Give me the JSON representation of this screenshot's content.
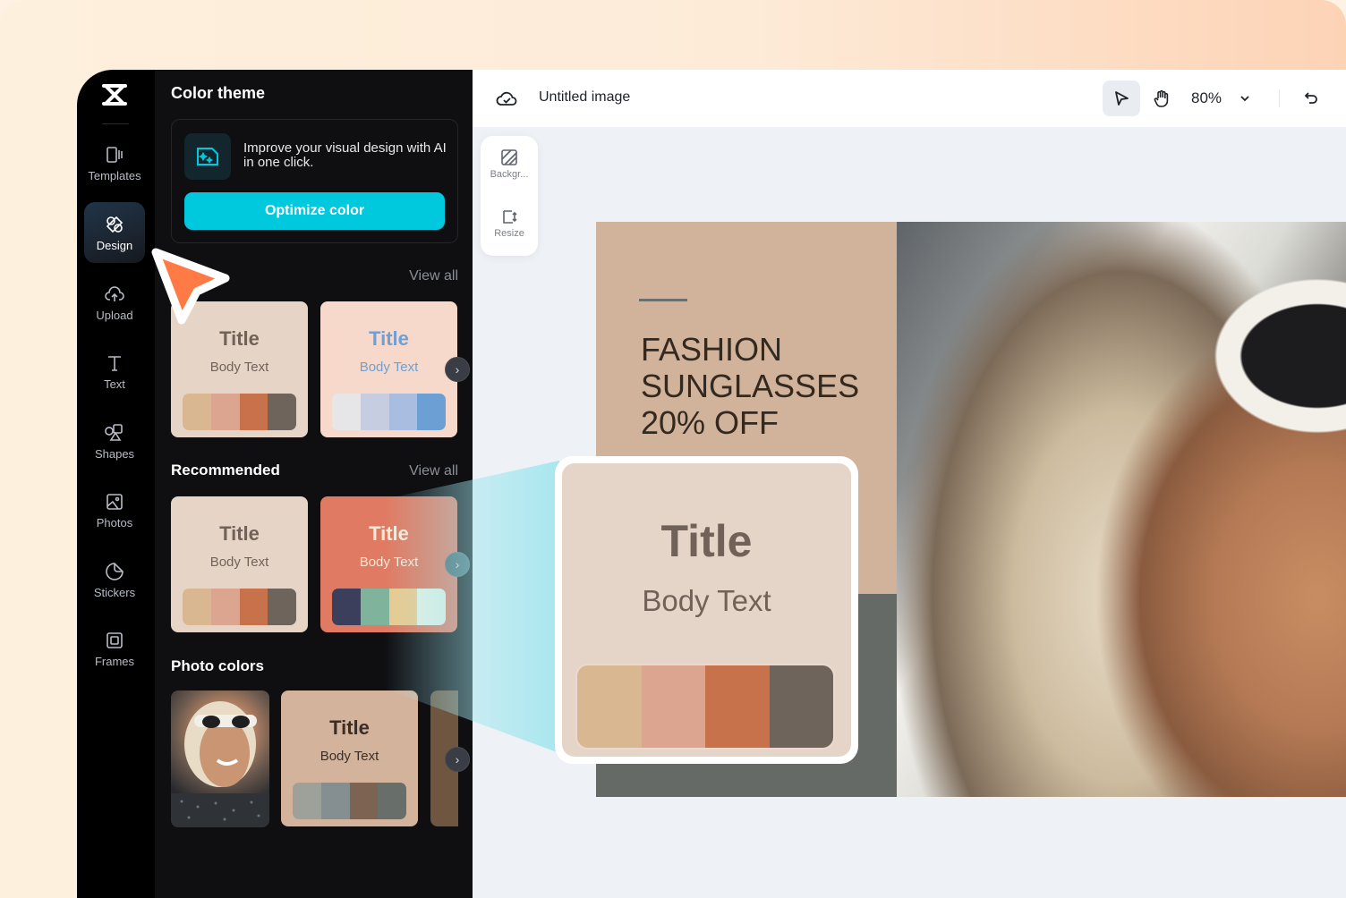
{
  "app": {
    "document_title": "Untitled image",
    "zoom_level": "80%"
  },
  "rail": {
    "logo": "capcut-logo-icon",
    "items": [
      {
        "label": "Templates",
        "icon": "templates-icon",
        "active": false
      },
      {
        "label": "Design",
        "icon": "design-icon",
        "active": true
      },
      {
        "label": "Upload",
        "icon": "upload-cloud-icon",
        "active": false
      },
      {
        "label": "Text",
        "icon": "text-icon",
        "active": false
      },
      {
        "label": "Shapes",
        "icon": "shapes-icon",
        "active": false
      },
      {
        "label": "Photos",
        "icon": "photos-icon",
        "active": false
      },
      {
        "label": "Stickers",
        "icon": "stickers-icon",
        "active": false
      },
      {
        "label": "Frames",
        "icon": "frames-icon",
        "active": false
      }
    ]
  },
  "panel": {
    "title": "Color theme",
    "ai_card": {
      "text": "Improve your visual design with AI in one click.",
      "button": "Optimize color"
    },
    "sections": {
      "first": {
        "view_all": "View all",
        "cards": [
          {
            "title": "Title",
            "body": "Body Text",
            "bg": "#e6d5c7",
            "text_color": "#716259",
            "palette": [
              "#d9b790",
              "#dba590",
              "#c8724c",
              "#6f645c"
            ]
          },
          {
            "title": "Title",
            "body": "Body Text",
            "bg": "#f6d9ca",
            "text_color": "#6f9fd4",
            "palette": [
              "#e6e6e8",
              "#c7cde0",
              "#a9bde0",
              "#6c9fd4"
            ]
          }
        ]
      },
      "recommended": {
        "title": "Recommended",
        "view_all": "View all",
        "cards": [
          {
            "title": "Title",
            "body": "Body Text",
            "bg": "#e6d5c7",
            "text_color": "#716259",
            "palette": [
              "#d9b790",
              "#dba590",
              "#c8724c",
              "#6f645c"
            ]
          },
          {
            "title": "Title",
            "body": "Body Text",
            "bg": "#e07a62",
            "text_color": "#f6ead9",
            "palette": [
              "#3b3f5c",
              "#7fb39c",
              "#e9ca8f",
              "#e2f0e4"
            ]
          }
        ]
      },
      "photo_colors": {
        "title": "Photo colors",
        "cards": [
          {
            "title": "Title",
            "body": "Body Text",
            "bg": "#d3b39c",
            "text_color": "#3b2e26",
            "palette": [
              "#9ea09a",
              "#858f91",
              "#7d6352",
              "#686e6a"
            ]
          }
        ]
      }
    }
  },
  "side_toolbar": {
    "items": [
      {
        "label": "Backgr...",
        "icon": "background-icon"
      },
      {
        "label": "Resize",
        "icon": "resize-icon"
      }
    ]
  },
  "canvas": {
    "headline": "FASHION\nSUNGLASSES\n20% OFF",
    "top_bg": "#d1b39c",
    "bottom_bg": "#656a66"
  },
  "zoom_preview": {
    "title": "Title",
    "body": "Body Text",
    "palette": [
      "#d9b790",
      "#dba590",
      "#c8724c",
      "#6f645c"
    ]
  },
  "colors": {
    "accent": "#00c8dd",
    "cursor": "#ff7a45"
  }
}
